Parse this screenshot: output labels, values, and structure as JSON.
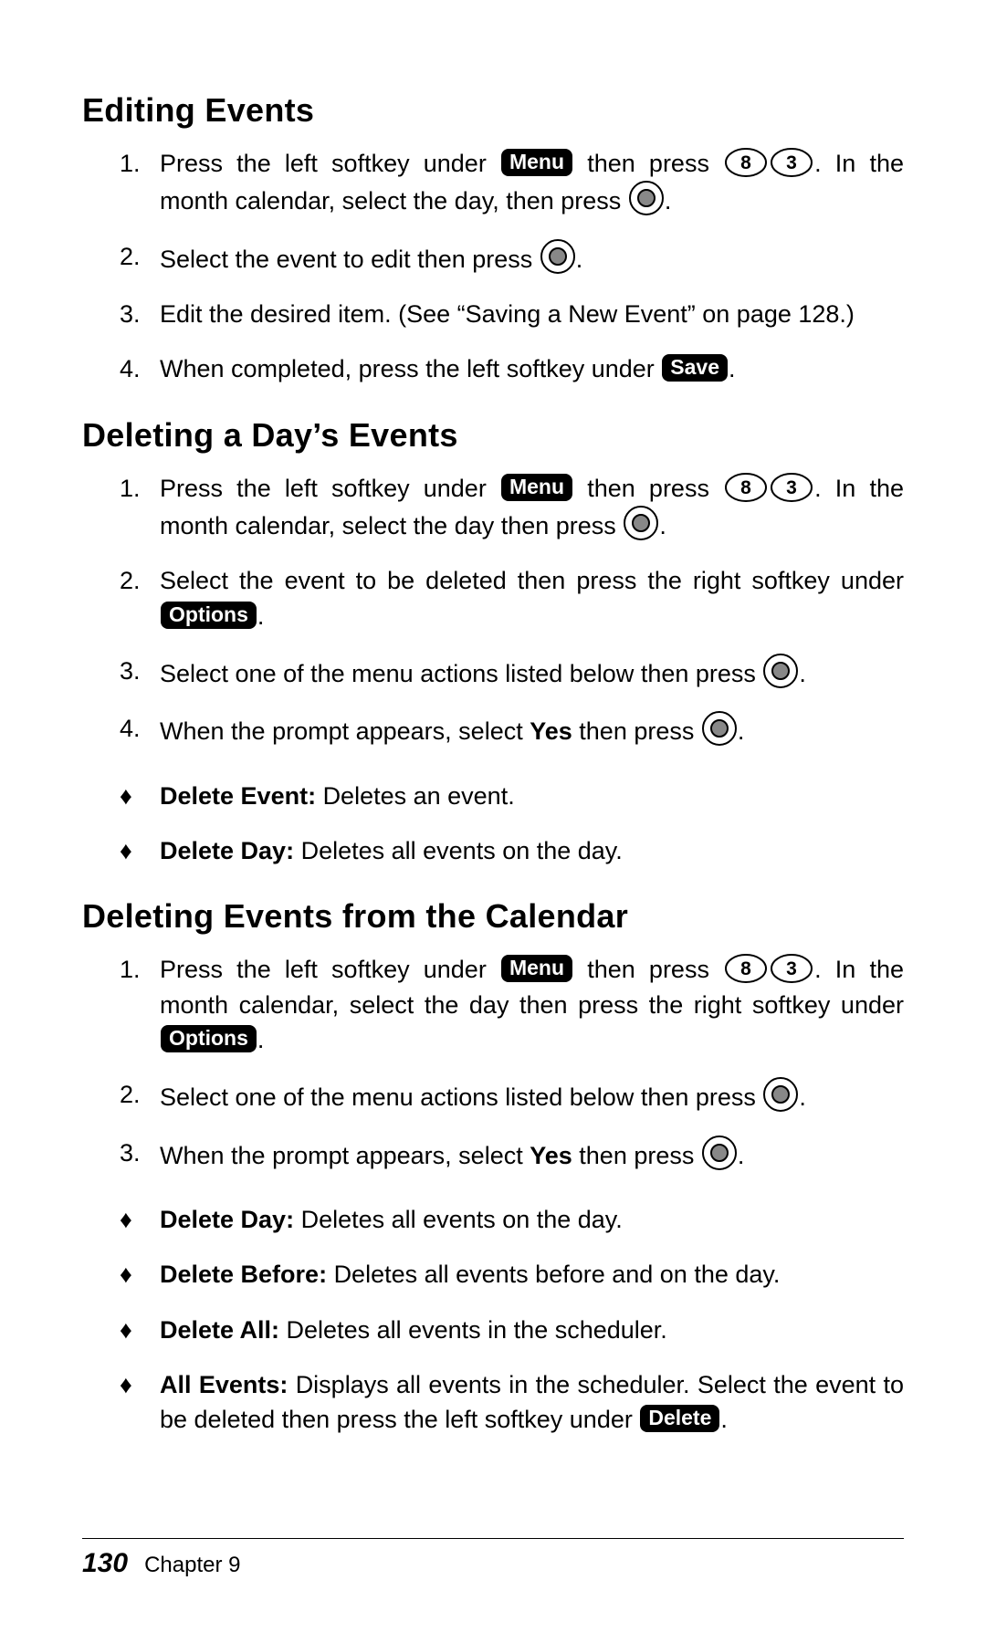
{
  "sections": {
    "editing": {
      "heading": "Editing Events",
      "s1a": "Press the left softkey under ",
      "s1_softkey": "Menu",
      "s1b": " then press ",
      "s1c": ". In the month calendar, select the day, then press ",
      "s1d": ".",
      "s2a": "Select the event to edit then press ",
      "s2b": ".",
      "s3": "Edit the desired item. (See “Saving a New Event” on page 128.)",
      "s4a": "When completed, press the left softkey under ",
      "s4_softkey": "Save",
      "s4b": "."
    },
    "deleteday": {
      "heading": "Deleting a Day’s Events",
      "s1a": "Press the left softkey under ",
      "s1_softkey": "Menu",
      "s1b": " then press ",
      "s1c": ". In the month calendar, select the day then press ",
      "s1d": ".",
      "s2a": "Select the event to be deleted then press the right softkey under ",
      "s2_softkey": "Options",
      "s2b": ".",
      "s3a": "Select one of the menu actions listed below then press ",
      "s3b": ".",
      "s4a": "When the prompt appears, select ",
      "s4bold": "Yes",
      "s4b": " then press ",
      "s4c": ".",
      "b1_label": "Delete Event: ",
      "b1_text": "Deletes an event.",
      "b2_label": "Delete Day: ",
      "b2_text": "Deletes all events on the day."
    },
    "deletecal": {
      "heading": "Deleting Events from the Calendar",
      "s1a": "Press the left softkey under ",
      "s1_softkey": "Menu",
      "s1b": " then press ",
      "s1c": ". In the month calendar, select the day then press the right softkey under ",
      "s1_softkey2": "Options",
      "s1d": ".",
      "s2a": "Select one of the menu actions listed below then press ",
      "s2b": ".",
      "s3a": "When the prompt appears, select ",
      "s3bold": "Yes",
      "s3b": " then press ",
      "s3c": ".",
      "b1_label": "Delete Day: ",
      "b1_text": "Deletes all events on the day.",
      "b2_label": "Delete Before: ",
      "b2_text": "Deletes all events before and on the day.",
      "b3_label": "Delete All: ",
      "b3_text": "Deletes all events in the scheduler.",
      "b4_label": "All Events: ",
      "b4a": "Displays all events in the scheduler. Select the event to be deleted then press the left softkey under ",
      "b4_softkey": "Delete",
      "b4b": "."
    }
  },
  "keys": {
    "eight": "8",
    "three": "3"
  },
  "footer": {
    "pagenum": "130",
    "chapter": "Chapter 9"
  }
}
